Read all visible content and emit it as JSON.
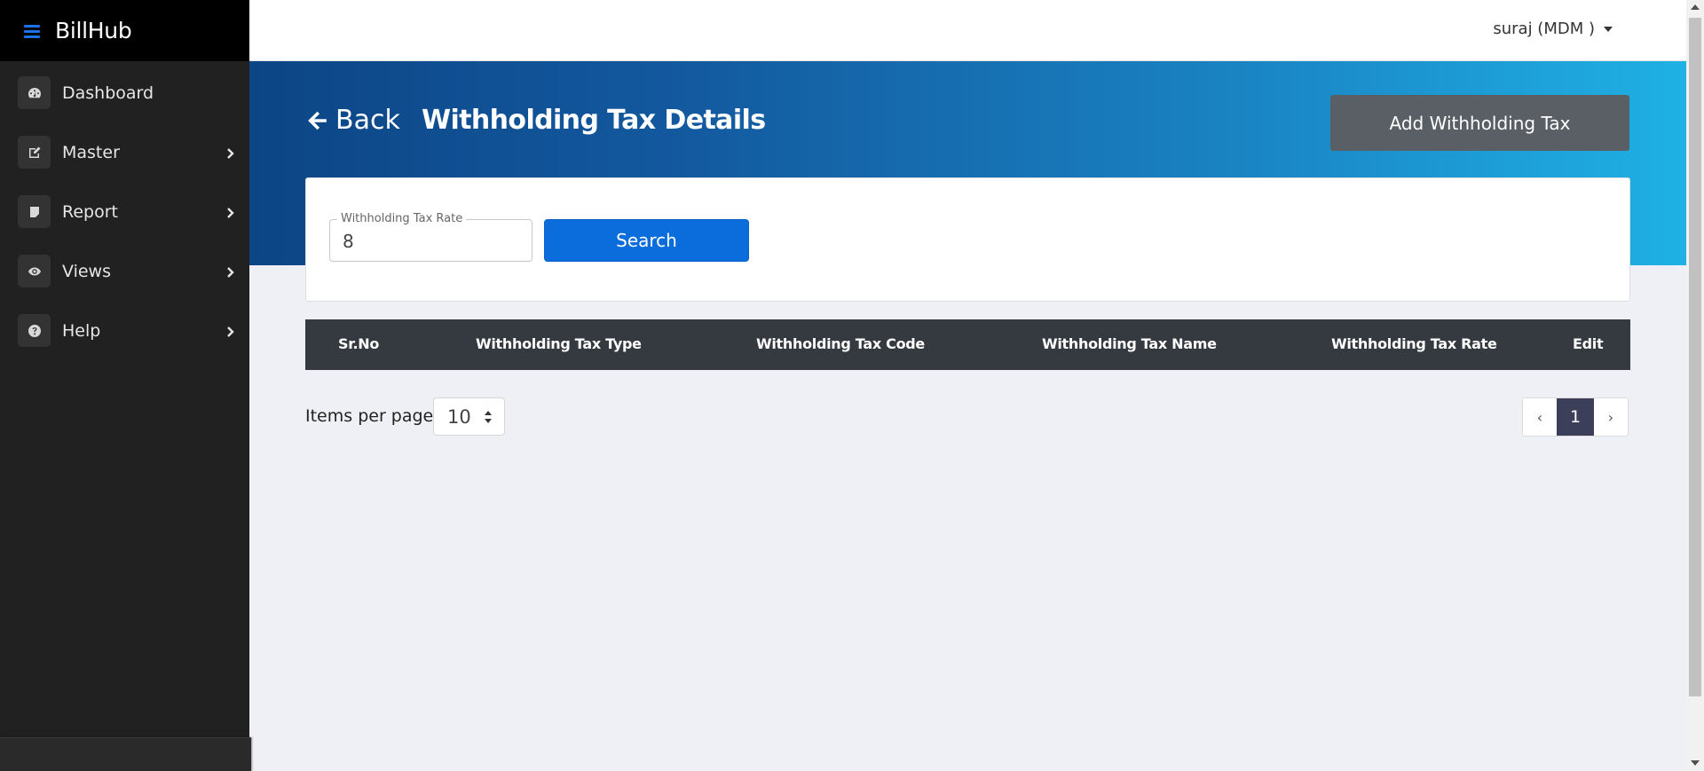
{
  "app": {
    "brand": "BillHub"
  },
  "sidebar": {
    "items": [
      {
        "label": "Dashboard",
        "icon": "dashboard-icon",
        "has_submenu": false
      },
      {
        "label": "Master",
        "icon": "edit-icon",
        "has_submenu": true
      },
      {
        "label": "Report",
        "icon": "note-icon",
        "has_submenu": true
      },
      {
        "label": "Views",
        "icon": "eye-icon",
        "has_submenu": true
      },
      {
        "label": "Help",
        "icon": "question-icon",
        "has_submenu": true
      }
    ]
  },
  "topbar": {
    "user": "suraj (MDM )"
  },
  "header": {
    "back_label": "Back",
    "title": "Withholding Tax Details",
    "add_button": "Add Withholding Tax"
  },
  "search": {
    "field_label": "Withholding Tax Rate",
    "field_value": "8",
    "button_label": "Search"
  },
  "table": {
    "columns": [
      "Sr.No",
      "Withholding Tax Type",
      "Withholding Tax Code",
      "Withholding Tax Name",
      "Withholding Tax Rate",
      "Edit"
    ],
    "rows": []
  },
  "pagination": {
    "items_per_page_label": "Items per page",
    "items_per_page": "10",
    "prev": "‹",
    "current_page": "1",
    "next": "›"
  },
  "colors": {
    "sidebar_bg": "#212121",
    "brand_bg": "#000000",
    "accent": "#1a73e8",
    "banner_start": "#0c4585",
    "banner_end": "#1fb1e4",
    "search_button": "#0a6ddb",
    "add_button": "#5a5f66",
    "table_header": "#343a40",
    "active_page": "#3c3f5a"
  }
}
